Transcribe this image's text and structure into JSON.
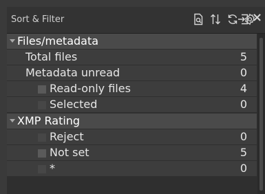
{
  "panel": {
    "title": "Sort & Filter",
    "toolbar": {
      "icons": [
        "document-search-icon",
        "sort-icon",
        "refresh-icon",
        "settings-icon",
        "dock-icon",
        "close-icon"
      ],
      "close_label": "×"
    }
  },
  "sections": [
    {
      "label": "Files/metadata",
      "rows": [
        {
          "label": "Total files",
          "value": "5"
        },
        {
          "label": "Metadata unread",
          "value": "0"
        },
        {
          "label": "Read-only files",
          "value": "4"
        },
        {
          "label": "Selected",
          "value": "0"
        }
      ]
    },
    {
      "label": "XMP Rating",
      "rows": [
        {
          "label": "Reject",
          "value": "0"
        },
        {
          "label": "Not set",
          "value": "5"
        },
        {
          "label": "*",
          "value": "0"
        }
      ]
    }
  ],
  "colors": {
    "panel_bg": "#2f2f2f",
    "section_bg": "#4a4a4a",
    "row_bg": "#3d3d3d",
    "text": "#e6e6e6"
  }
}
